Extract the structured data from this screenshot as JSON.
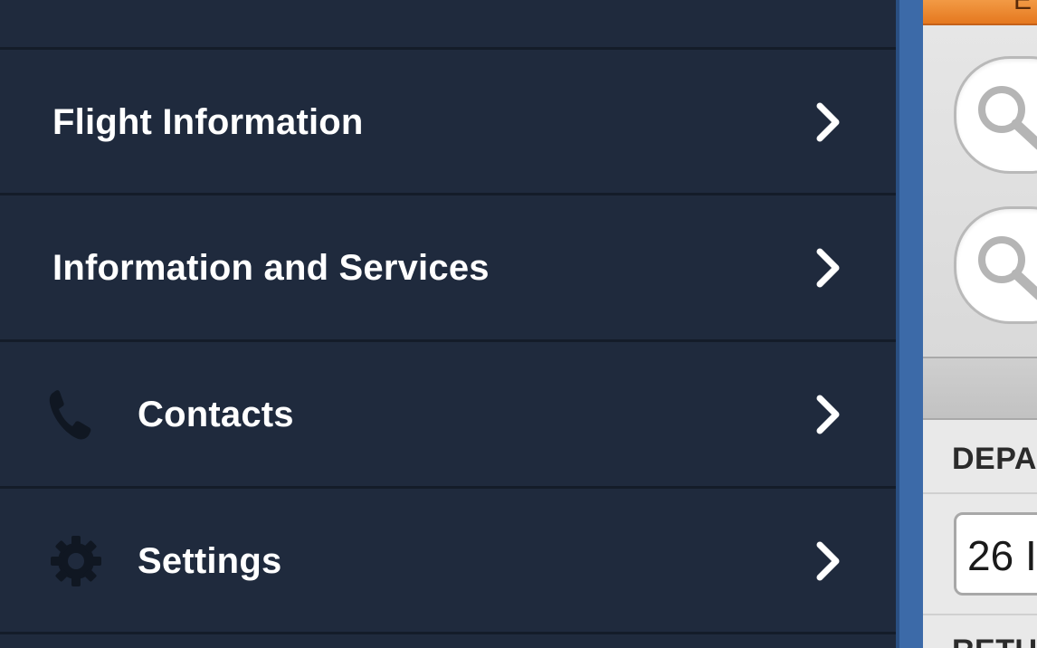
{
  "drawer": {
    "items": [
      {
        "label": "Flight Information",
        "icon": "none"
      },
      {
        "label": "Information and Services",
        "icon": "none"
      },
      {
        "label": "Contacts",
        "icon": "phone-icon"
      },
      {
        "label": "Settings",
        "icon": "gear-icon"
      }
    ]
  },
  "panel": {
    "top_bar_text": "E",
    "depart_label": "DEPA",
    "date_value": "26 I",
    "return_label": "RETU"
  },
  "colors": {
    "drawer_bg": "#1f2a3d",
    "divider": "#141c29",
    "accent_orange": "#e5781f",
    "panel_edge_blue": "#3c6aa8"
  }
}
